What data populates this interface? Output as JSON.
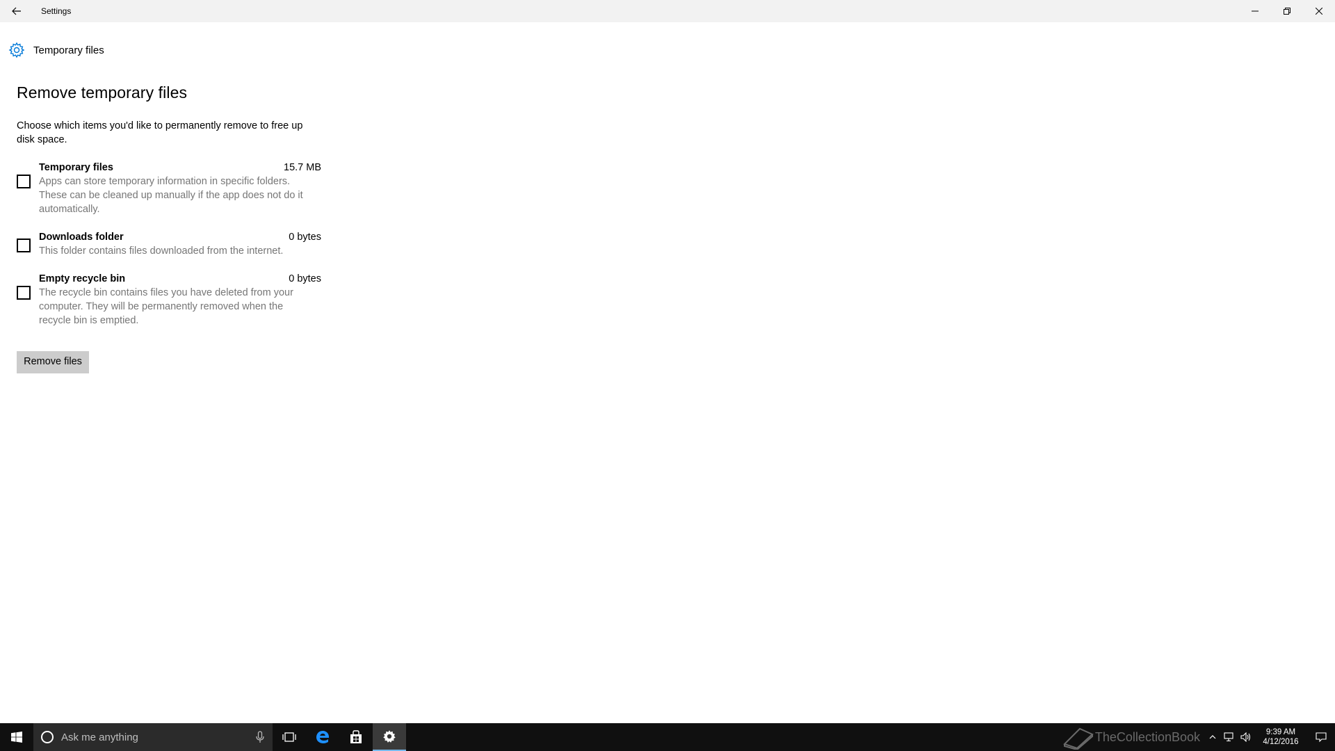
{
  "window": {
    "title": "Settings",
    "back_icon": "back-arrow-icon",
    "minimize_icon": "minimize-icon",
    "restore_icon": "restore-icon",
    "close_icon": "close-icon"
  },
  "header": {
    "icon": "gear-icon",
    "title": "Temporary files"
  },
  "main": {
    "section_title": "Remove temporary files",
    "intro": "Choose which items you'd like to permanently remove to free up disk space.",
    "items": [
      {
        "name": "Temporary files",
        "size": "15.7 MB",
        "description": "Apps can store temporary information in specific folders. These can be cleaned up manually if the app does not do it automatically.",
        "checked": false
      },
      {
        "name": "Downloads folder",
        "size": "0 bytes",
        "description": "This folder contains files downloaded from the internet.",
        "checked": false
      },
      {
        "name": "Empty recycle bin",
        "size": "0 bytes",
        "description": "The recycle bin contains files you have deleted from your computer. They will be permanently removed when the recycle bin is emptied.",
        "checked": false
      }
    ],
    "remove_button": "Remove files"
  },
  "taskbar": {
    "search_placeholder": "Ask me anything",
    "apps": [
      "task-view-icon",
      "edge-icon",
      "store-icon",
      "settings-icon"
    ],
    "watermark": "TheCollectionBook",
    "time": "9:39 AM",
    "date": "4/12/2016"
  },
  "colors": {
    "accent": "#0078d7",
    "titlebar_bg": "#f2f2f2",
    "description_text": "#767676",
    "button_bg": "#cccccc",
    "taskbar_bg": "#101010"
  }
}
